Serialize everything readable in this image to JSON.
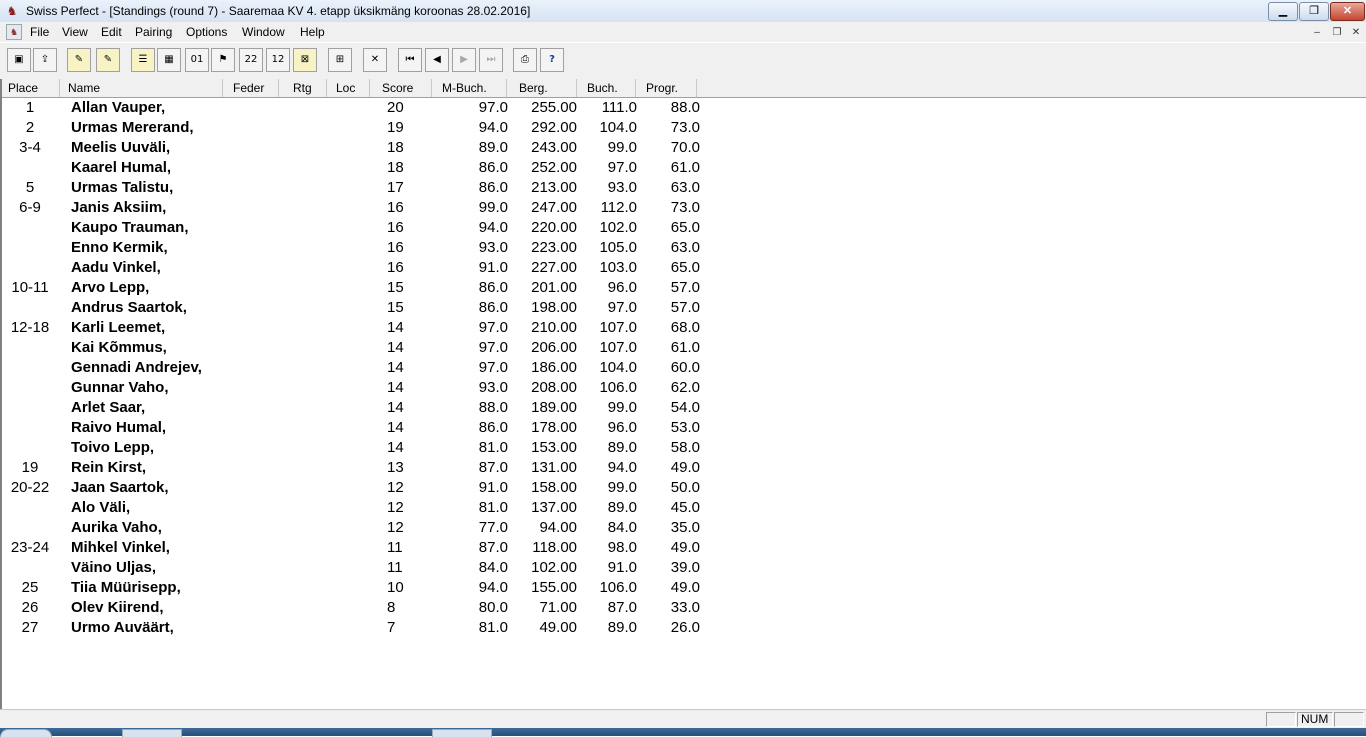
{
  "window": {
    "title": "Swiss Perfect - [Standings  (round 7) - Saaremaa KV 4. etapp üksikmäng koroonas 28.02.2016]",
    "app_icon": "chess-pieces-icon",
    "controls": [
      "minimize",
      "restore",
      "close"
    ]
  },
  "menu": {
    "items": [
      "File",
      "View",
      "Edit",
      "Pairing",
      "Options",
      "Window",
      "Help"
    ],
    "doc_icon": "document-icon"
  },
  "toolbar": {
    "buttons": [
      {
        "name": "new-tournament-icon",
        "glyph": "▣"
      },
      {
        "name": "open-tournament-icon",
        "glyph": "⇪"
      },
      {
        "name": "pen-edit-icon",
        "glyph": "✎"
      },
      {
        "name": "pen-edit-all-icon",
        "glyph": "✎"
      },
      {
        "name": "players-list-icon",
        "glyph": "☰"
      },
      {
        "name": "table-view-icon",
        "glyph": "▦"
      },
      {
        "name": "binary-icon",
        "glyph": "01"
      },
      {
        "name": "pairing-icon",
        "glyph": "⚑"
      },
      {
        "name": "number-2285-icon",
        "glyph": "22"
      },
      {
        "name": "number-1236-icon",
        "glyph": "12"
      },
      {
        "name": "crosstable-icon",
        "glyph": "⊠"
      },
      {
        "name": "standings-table-icon",
        "glyph": "⊞"
      },
      {
        "name": "delete-round-icon",
        "glyph": "✕"
      },
      {
        "name": "first-round-icon",
        "glyph": "⏮"
      },
      {
        "name": "previous-round-icon",
        "glyph": "◀"
      },
      {
        "name": "next-round-icon",
        "glyph": "▶"
      },
      {
        "name": "last-round-icon",
        "glyph": "⏭"
      },
      {
        "name": "print-icon",
        "glyph": "⎙"
      },
      {
        "name": "help-icon",
        "glyph": "?"
      }
    ]
  },
  "table": {
    "headers": [
      "Place",
      "Name",
      "Feder",
      "Rtg",
      "Loc",
      "Score",
      "M-Buch.",
      "Berg.",
      "Buch.",
      "Progr."
    ],
    "rows": [
      {
        "place": "1",
        "name": "Allan Vauper,",
        "score": "20",
        "mbuch": "97.0",
        "berg": "255.00",
        "buch": "111.0",
        "progr": "88.0"
      },
      {
        "place": "2",
        "name": "Urmas Mererand,",
        "score": "19",
        "mbuch": "94.0",
        "berg": "292.00",
        "buch": "104.0",
        "progr": "73.0"
      },
      {
        "place": "3-4",
        "name": "Meelis Uuväli,",
        "score": "18",
        "mbuch": "89.0",
        "berg": "243.00",
        "buch": "99.0",
        "progr": "70.0"
      },
      {
        "place": "",
        "name": "Kaarel Humal,",
        "score": "18",
        "mbuch": "86.0",
        "berg": "252.00",
        "buch": "97.0",
        "progr": "61.0"
      },
      {
        "place": "5",
        "name": "Urmas Talistu,",
        "score": "17",
        "mbuch": "86.0",
        "berg": "213.00",
        "buch": "93.0",
        "progr": "63.0"
      },
      {
        "place": "6-9",
        "name": "Janis Aksiim,",
        "score": "16",
        "mbuch": "99.0",
        "berg": "247.00",
        "buch": "112.0",
        "progr": "73.0"
      },
      {
        "place": "",
        "name": "Kaupo Trauman,",
        "score": "16",
        "mbuch": "94.0",
        "berg": "220.00",
        "buch": "102.0",
        "progr": "65.0"
      },
      {
        "place": "",
        "name": "Enno Kermik,",
        "score": "16",
        "mbuch": "93.0",
        "berg": "223.00",
        "buch": "105.0",
        "progr": "63.0"
      },
      {
        "place": "",
        "name": "Aadu Vinkel,",
        "score": "16",
        "mbuch": "91.0",
        "berg": "227.00",
        "buch": "103.0",
        "progr": "65.0"
      },
      {
        "place": "10-11",
        "name": "Arvo Lepp,",
        "score": "15",
        "mbuch": "86.0",
        "berg": "201.00",
        "buch": "96.0",
        "progr": "57.0"
      },
      {
        "place": "",
        "name": "Andrus Saartok,",
        "score": "15",
        "mbuch": "86.0",
        "berg": "198.00",
        "buch": "97.0",
        "progr": "57.0"
      },
      {
        "place": "12-18",
        "name": "Karli Leemet,",
        "score": "14",
        "mbuch": "97.0",
        "berg": "210.00",
        "buch": "107.0",
        "progr": "68.0"
      },
      {
        "place": "",
        "name": "Kai Kõmmus,",
        "score": "14",
        "mbuch": "97.0",
        "berg": "206.00",
        "buch": "107.0",
        "progr": "61.0"
      },
      {
        "place": "",
        "name": "Gennadi Andrejev,",
        "score": "14",
        "mbuch": "97.0",
        "berg": "186.00",
        "buch": "104.0",
        "progr": "60.0"
      },
      {
        "place": "",
        "name": "Gunnar Vaho,",
        "score": "14",
        "mbuch": "93.0",
        "berg": "208.00",
        "buch": "106.0",
        "progr": "62.0"
      },
      {
        "place": "",
        "name": "Arlet Saar,",
        "score": "14",
        "mbuch": "88.0",
        "berg": "189.00",
        "buch": "99.0",
        "progr": "54.0"
      },
      {
        "place": "",
        "name": "Raivo Humal,",
        "score": "14",
        "mbuch": "86.0",
        "berg": "178.00",
        "buch": "96.0",
        "progr": "53.0"
      },
      {
        "place": "",
        "name": "Toivo Lepp,",
        "score": "14",
        "mbuch": "81.0",
        "berg": "153.00",
        "buch": "89.0",
        "progr": "58.0"
      },
      {
        "place": "19",
        "name": "Rein Kirst,",
        "score": "13",
        "mbuch": "87.0",
        "berg": "131.00",
        "buch": "94.0",
        "progr": "49.0"
      },
      {
        "place": "20-22",
        "name": "Jaan Saartok,",
        "score": "12",
        "mbuch": "91.0",
        "berg": "158.00",
        "buch": "99.0",
        "progr": "50.0"
      },
      {
        "place": "",
        "name": "Alo Väli,",
        "score": "12",
        "mbuch": "81.0",
        "berg": "137.00",
        "buch": "89.0",
        "progr": "45.0"
      },
      {
        "place": "",
        "name": "Aurika Vaho,",
        "score": "12",
        "mbuch": "77.0",
        "berg": "94.00",
        "buch": "84.0",
        "progr": "35.0"
      },
      {
        "place": "23-24",
        "name": "Mihkel Vinkel,",
        "score": "11",
        "mbuch": "87.0",
        "berg": "118.00",
        "buch": "98.0",
        "progr": "49.0"
      },
      {
        "place": "",
        "name": "Väino Uljas,",
        "score": "11",
        "mbuch": "84.0",
        "berg": "102.00",
        "buch": "91.0",
        "progr": "39.0"
      },
      {
        "place": "25",
        "name": "Tiia Müürisepp,",
        "score": "10",
        "mbuch": "94.0",
        "berg": "155.00",
        "buch": "106.0",
        "progr": "49.0"
      },
      {
        "place": "26",
        "name": "Olev Kiirend,",
        "score": "8",
        "mbuch": "80.0",
        "berg": "71.00",
        "buch": "87.0",
        "progr": "33.0"
      },
      {
        "place": "27",
        "name": "Urmo Auväärt,",
        "score": "7",
        "mbuch": "81.0",
        "berg": "49.00",
        "buch": "89.0",
        "progr": "26.0"
      }
    ]
  },
  "status": {
    "num": "NUM"
  },
  "colors": {
    "titlebar": "#dbe6f4",
    "chrome": "#f0f0f0",
    "taskbar": "#2b4f78"
  }
}
